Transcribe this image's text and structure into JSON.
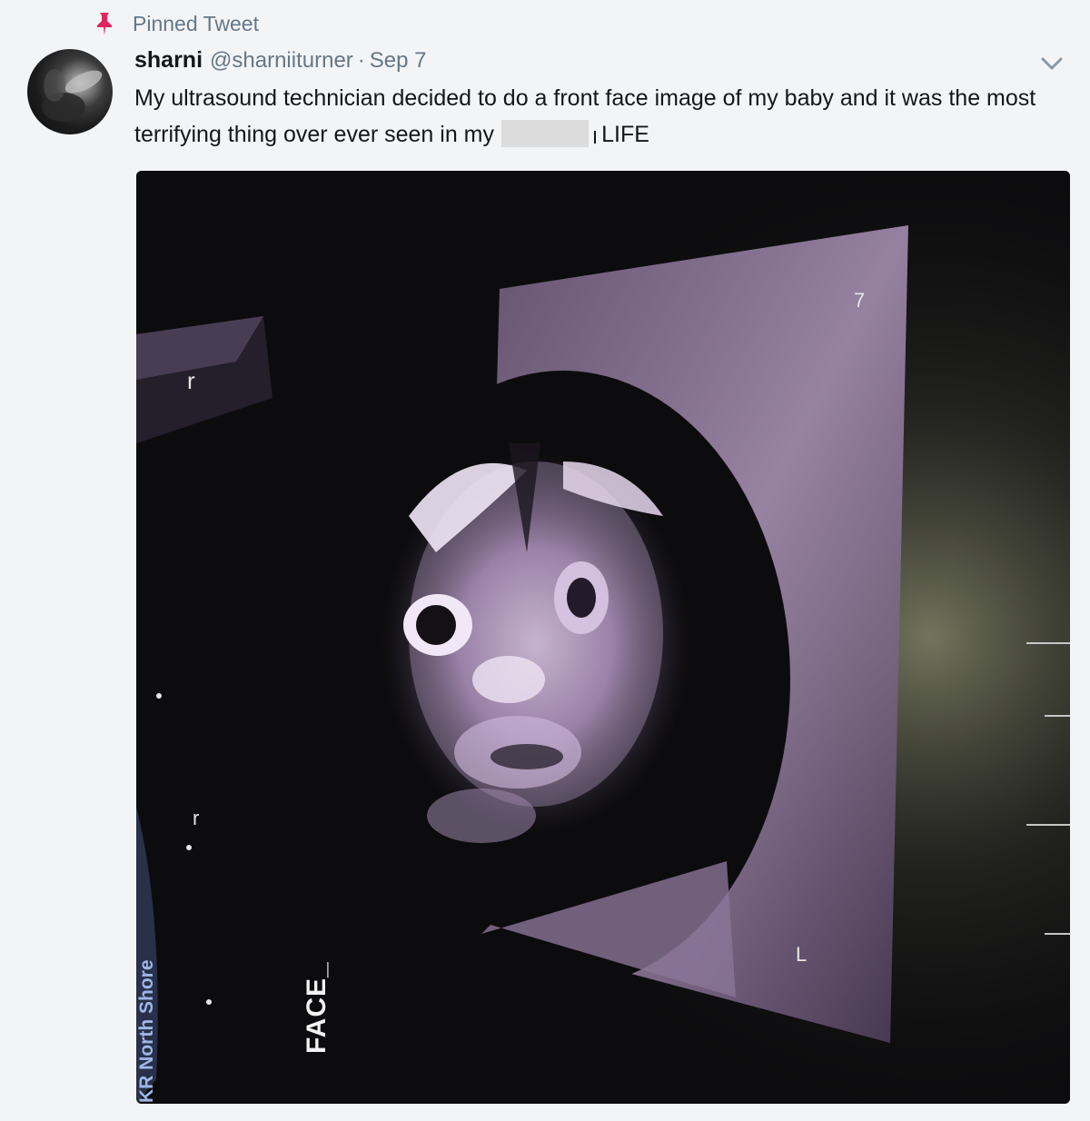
{
  "pinned": {
    "label": "Pinned Tweet",
    "icon": "pin-icon",
    "icon_color": "#e0245e"
  },
  "author": {
    "name": "sharni",
    "handle": "@sharniiturner",
    "separator": "·",
    "date": "Sep 7"
  },
  "tweet": {
    "text_before": "My ultrasound technician decided to do a front face image of my baby and it was the most terrifying thing over ever seen in my",
    "text_after": "LIFE"
  },
  "menu": {
    "icon": "chevron-down-icon"
  },
  "media": {
    "type": "ultrasound photo",
    "face_label": "FACE_",
    "brand_label": "KR North Shore"
  },
  "colors": {
    "text_primary": "#14171a",
    "text_secondary": "#657786",
    "background": "#f3f4f6"
  }
}
